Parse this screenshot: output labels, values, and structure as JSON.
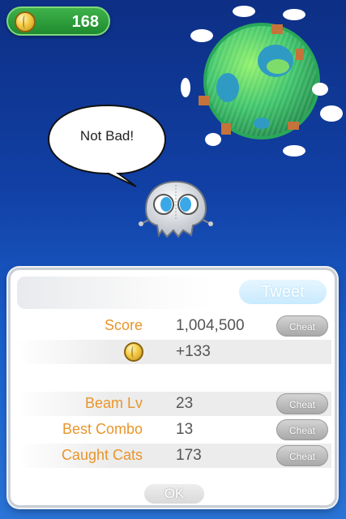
{
  "hud": {
    "coin_count": "168"
  },
  "speech": {
    "text": "Not Bad!"
  },
  "results": {
    "tweet_label": "Tweet",
    "score": {
      "label": "Score",
      "value": "1,004,500",
      "cheat_label": "Cheat"
    },
    "coins": {
      "value": "+133"
    },
    "beam_lv": {
      "label": "Beam Lv",
      "value": "23",
      "cheat_label": "Cheat"
    },
    "best_combo": {
      "label": "Best Combo",
      "value": "13",
      "cheat_label": "Cheat"
    },
    "caught_cats": {
      "label": "Caught Cats",
      "value": "173",
      "cheat_label": "Cheat"
    },
    "ok_label": "OK"
  },
  "colors": {
    "label_orange": "#e8952a",
    "hud_green": "#2b9c3a",
    "planet_green": "#3ec46a",
    "sky_blue": "#1a5fcc"
  },
  "icons": [
    "coin-icon",
    "planet-icon",
    "cloud-icon",
    "speech-bubble-icon",
    "skull-icon"
  ]
}
